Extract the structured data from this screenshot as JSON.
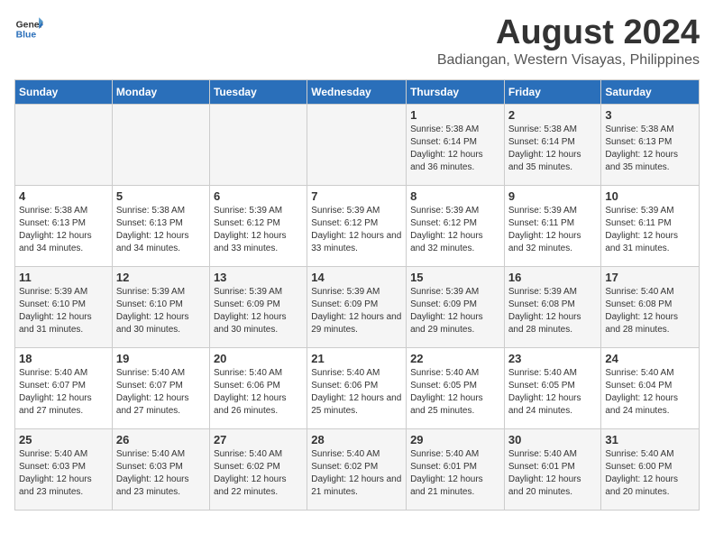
{
  "logo": {
    "text_general": "General",
    "text_blue": "Blue"
  },
  "title": "August 2024",
  "location": "Badiangan, Western Visayas, Philippines",
  "days_of_week": [
    "Sunday",
    "Monday",
    "Tuesday",
    "Wednesday",
    "Thursday",
    "Friday",
    "Saturday"
  ],
  "weeks": [
    [
      {
        "day": "",
        "sunrise": "",
        "sunset": "",
        "daylight": ""
      },
      {
        "day": "",
        "sunrise": "",
        "sunset": "",
        "daylight": ""
      },
      {
        "day": "",
        "sunrise": "",
        "sunset": "",
        "daylight": ""
      },
      {
        "day": "",
        "sunrise": "",
        "sunset": "",
        "daylight": ""
      },
      {
        "day": "1",
        "sunrise": "Sunrise: 5:38 AM",
        "sunset": "Sunset: 6:14 PM",
        "daylight": "Daylight: 12 hours and 36 minutes."
      },
      {
        "day": "2",
        "sunrise": "Sunrise: 5:38 AM",
        "sunset": "Sunset: 6:14 PM",
        "daylight": "Daylight: 12 hours and 35 minutes."
      },
      {
        "day": "3",
        "sunrise": "Sunrise: 5:38 AM",
        "sunset": "Sunset: 6:13 PM",
        "daylight": "Daylight: 12 hours and 35 minutes."
      }
    ],
    [
      {
        "day": "4",
        "sunrise": "Sunrise: 5:38 AM",
        "sunset": "Sunset: 6:13 PM",
        "daylight": "Daylight: 12 hours and 34 minutes."
      },
      {
        "day": "5",
        "sunrise": "Sunrise: 5:38 AM",
        "sunset": "Sunset: 6:13 PM",
        "daylight": "Daylight: 12 hours and 34 minutes."
      },
      {
        "day": "6",
        "sunrise": "Sunrise: 5:39 AM",
        "sunset": "Sunset: 6:12 PM",
        "daylight": "Daylight: 12 hours and 33 minutes."
      },
      {
        "day": "7",
        "sunrise": "Sunrise: 5:39 AM",
        "sunset": "Sunset: 6:12 PM",
        "daylight": "Daylight: 12 hours and 33 minutes."
      },
      {
        "day": "8",
        "sunrise": "Sunrise: 5:39 AM",
        "sunset": "Sunset: 6:12 PM",
        "daylight": "Daylight: 12 hours and 32 minutes."
      },
      {
        "day": "9",
        "sunrise": "Sunrise: 5:39 AM",
        "sunset": "Sunset: 6:11 PM",
        "daylight": "Daylight: 12 hours and 32 minutes."
      },
      {
        "day": "10",
        "sunrise": "Sunrise: 5:39 AM",
        "sunset": "Sunset: 6:11 PM",
        "daylight": "Daylight: 12 hours and 31 minutes."
      }
    ],
    [
      {
        "day": "11",
        "sunrise": "Sunrise: 5:39 AM",
        "sunset": "Sunset: 6:10 PM",
        "daylight": "Daylight: 12 hours and 31 minutes."
      },
      {
        "day": "12",
        "sunrise": "Sunrise: 5:39 AM",
        "sunset": "Sunset: 6:10 PM",
        "daylight": "Daylight: 12 hours and 30 minutes."
      },
      {
        "day": "13",
        "sunrise": "Sunrise: 5:39 AM",
        "sunset": "Sunset: 6:09 PM",
        "daylight": "Daylight: 12 hours and 30 minutes."
      },
      {
        "day": "14",
        "sunrise": "Sunrise: 5:39 AM",
        "sunset": "Sunset: 6:09 PM",
        "daylight": "Daylight: 12 hours and 29 minutes."
      },
      {
        "day": "15",
        "sunrise": "Sunrise: 5:39 AM",
        "sunset": "Sunset: 6:09 PM",
        "daylight": "Daylight: 12 hours and 29 minutes."
      },
      {
        "day": "16",
        "sunrise": "Sunrise: 5:39 AM",
        "sunset": "Sunset: 6:08 PM",
        "daylight": "Daylight: 12 hours and 28 minutes."
      },
      {
        "day": "17",
        "sunrise": "Sunrise: 5:40 AM",
        "sunset": "Sunset: 6:08 PM",
        "daylight": "Daylight: 12 hours and 28 minutes."
      }
    ],
    [
      {
        "day": "18",
        "sunrise": "Sunrise: 5:40 AM",
        "sunset": "Sunset: 6:07 PM",
        "daylight": "Daylight: 12 hours and 27 minutes."
      },
      {
        "day": "19",
        "sunrise": "Sunrise: 5:40 AM",
        "sunset": "Sunset: 6:07 PM",
        "daylight": "Daylight: 12 hours and 27 minutes."
      },
      {
        "day": "20",
        "sunrise": "Sunrise: 5:40 AM",
        "sunset": "Sunset: 6:06 PM",
        "daylight": "Daylight: 12 hours and 26 minutes."
      },
      {
        "day": "21",
        "sunrise": "Sunrise: 5:40 AM",
        "sunset": "Sunset: 6:06 PM",
        "daylight": "Daylight: 12 hours and 25 minutes."
      },
      {
        "day": "22",
        "sunrise": "Sunrise: 5:40 AM",
        "sunset": "Sunset: 6:05 PM",
        "daylight": "Daylight: 12 hours and 25 minutes."
      },
      {
        "day": "23",
        "sunrise": "Sunrise: 5:40 AM",
        "sunset": "Sunset: 6:05 PM",
        "daylight": "Daylight: 12 hours and 24 minutes."
      },
      {
        "day": "24",
        "sunrise": "Sunrise: 5:40 AM",
        "sunset": "Sunset: 6:04 PM",
        "daylight": "Daylight: 12 hours and 24 minutes."
      }
    ],
    [
      {
        "day": "25",
        "sunrise": "Sunrise: 5:40 AM",
        "sunset": "Sunset: 6:03 PM",
        "daylight": "Daylight: 12 hours and 23 minutes."
      },
      {
        "day": "26",
        "sunrise": "Sunrise: 5:40 AM",
        "sunset": "Sunset: 6:03 PM",
        "daylight": "Daylight: 12 hours and 23 minutes."
      },
      {
        "day": "27",
        "sunrise": "Sunrise: 5:40 AM",
        "sunset": "Sunset: 6:02 PM",
        "daylight": "Daylight: 12 hours and 22 minutes."
      },
      {
        "day": "28",
        "sunrise": "Sunrise: 5:40 AM",
        "sunset": "Sunset: 6:02 PM",
        "daylight": "Daylight: 12 hours and 21 minutes."
      },
      {
        "day": "29",
        "sunrise": "Sunrise: 5:40 AM",
        "sunset": "Sunset: 6:01 PM",
        "daylight": "Daylight: 12 hours and 21 minutes."
      },
      {
        "day": "30",
        "sunrise": "Sunrise: 5:40 AM",
        "sunset": "Sunset: 6:01 PM",
        "daylight": "Daylight: 12 hours and 20 minutes."
      },
      {
        "day": "31",
        "sunrise": "Sunrise: 5:40 AM",
        "sunset": "Sunset: 6:00 PM",
        "daylight": "Daylight: 12 hours and 20 minutes."
      }
    ]
  ]
}
